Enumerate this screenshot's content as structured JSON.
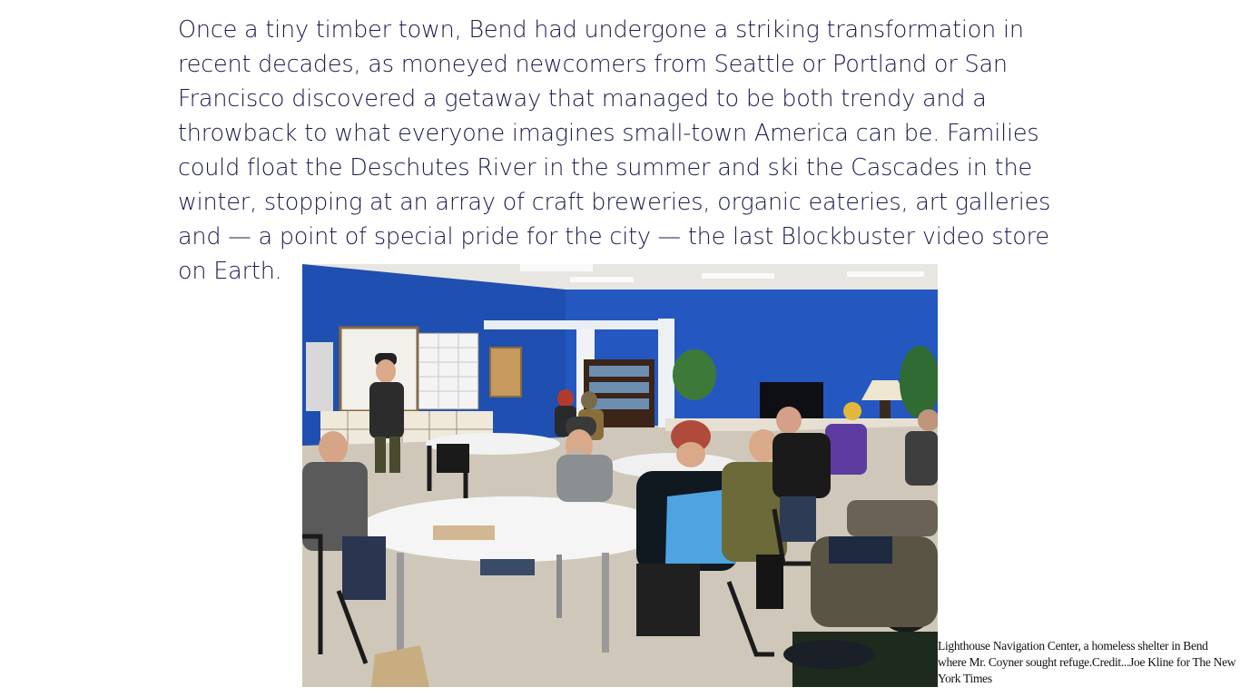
{
  "article": {
    "paragraph": "Once a tiny timber town, Bend had undergone a striking transformation in recent decades, as moneyed newcomers from Seattle or Portland or San Francisco discovered a getaway that managed to be both trendy and a throwback to what everyone imagines small-town America can be. Families could float the Deschutes River in the summer and ski the Cascades in the winter, stopping at an array of craft breweries, organic eateries, art galleries and — a point of special pride for the city — the last Blockbuster video store on Earth."
  },
  "figure": {
    "caption": "Lighthouse Navigation Center, a homeless shelter in Bend where Mr. Coyner sought refuge.",
    "credit_label": "Credit...",
    "credit": "Joe Kline for The New York Times"
  },
  "colors": {
    "text": "#1b1b4d",
    "wall_blue": "#1f4fb0",
    "floor": "#cfc8ba"
  }
}
